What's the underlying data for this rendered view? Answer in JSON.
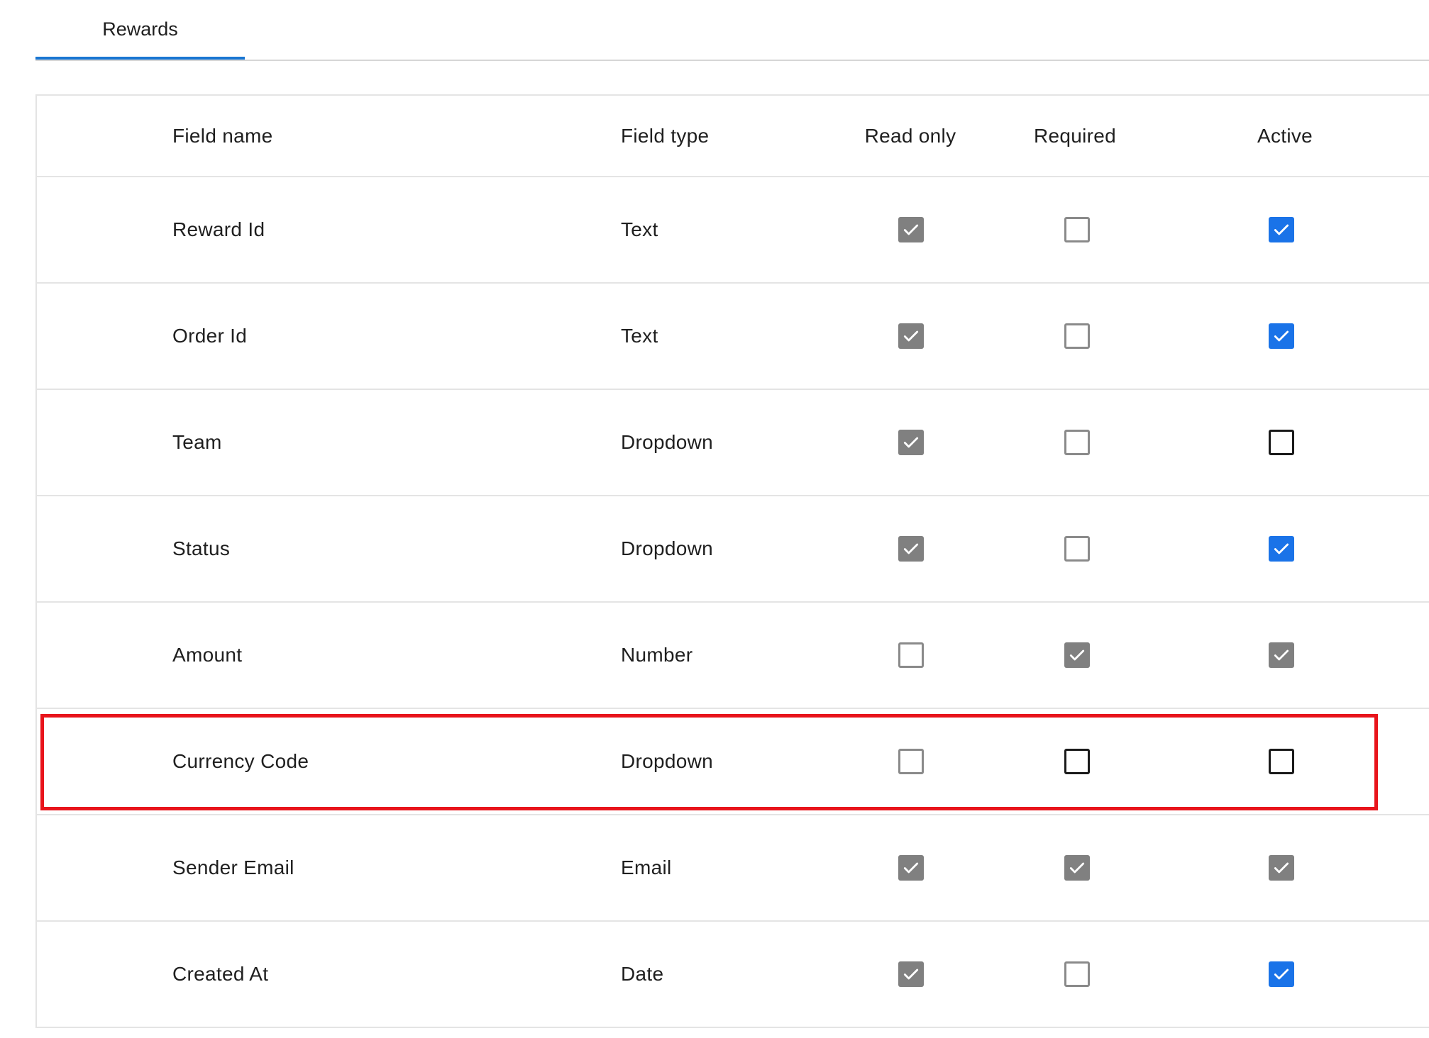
{
  "tabs": [
    {
      "label": "Rewards",
      "active": true
    }
  ],
  "table": {
    "headers": {
      "field_name": "Field name",
      "field_type": "Field type",
      "read_only": "Read only",
      "required": "Required",
      "active": "Active"
    },
    "rows": [
      {
        "name": "Reward Id",
        "type": "Text",
        "read_only": "checked-gray",
        "required": "unchecked-gray",
        "active": "checked-blue"
      },
      {
        "name": "Order Id",
        "type": "Text",
        "read_only": "checked-gray",
        "required": "unchecked-gray",
        "active": "checked-blue"
      },
      {
        "name": "Team",
        "type": "Dropdown",
        "read_only": "checked-gray",
        "required": "unchecked-gray",
        "active": "unchecked-black"
      },
      {
        "name": "Status",
        "type": "Dropdown",
        "read_only": "checked-gray",
        "required": "unchecked-gray",
        "active": "checked-blue"
      },
      {
        "name": "Amount",
        "type": "Number",
        "read_only": "unchecked-gray",
        "required": "checked-gray",
        "active": "checked-gray"
      },
      {
        "name": "Currency Code",
        "type": "Dropdown",
        "read_only": "unchecked-gray",
        "required": "unchecked-black",
        "active": "unchecked-black",
        "highlighted": true
      },
      {
        "name": "Sender Email",
        "type": "Email",
        "read_only": "checked-gray",
        "required": "checked-gray",
        "active": "checked-gray"
      },
      {
        "name": "Created At",
        "type": "Date",
        "read_only": "checked-gray",
        "required": "unchecked-gray",
        "active": "checked-blue"
      }
    ]
  },
  "colors": {
    "accent": "#1a73e8",
    "tab_underline": "#1976d2",
    "highlight": "#e8141b",
    "checked_disabled": "#808080"
  }
}
